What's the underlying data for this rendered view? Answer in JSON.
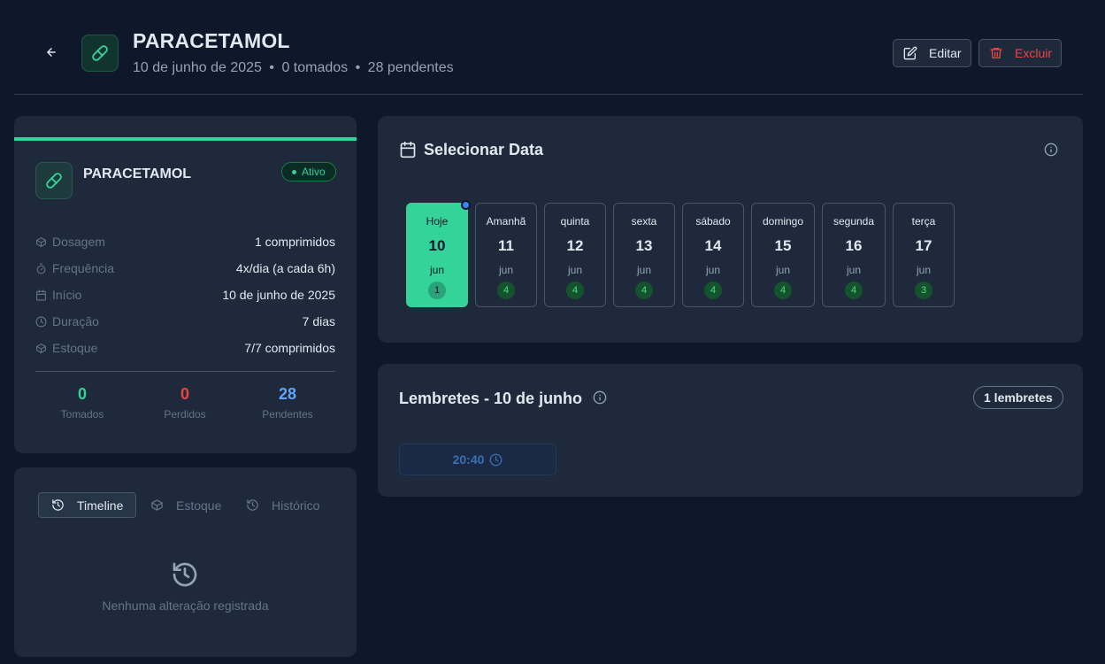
{
  "header": {
    "title": "PARACETAMOL",
    "subtitle": {
      "date": "10 de junho de 2025",
      "taken": "0 tomados",
      "pending": "28 pendentes",
      "separator": "•"
    },
    "edit_label": "Editar",
    "delete_label": "Excluir"
  },
  "medication": {
    "name": "PARACETAMOL",
    "status": "Ativo",
    "details": [
      {
        "icon": "box-icon",
        "label": "Dosagem",
        "value": "1 comprimidos"
      },
      {
        "icon": "timer-icon",
        "label": "Frequência",
        "value": "4x/dia (a cada 6h)"
      },
      {
        "icon": "calendar-icon",
        "label": "Início",
        "value": "10 de junho de 2025"
      },
      {
        "icon": "clock-icon",
        "label": "Duração",
        "value": "7 dias"
      },
      {
        "icon": "box-icon",
        "label": "Estoque",
        "value": "7/7 comprimidos"
      }
    ],
    "stats": [
      {
        "value": "0",
        "label": "Tomados",
        "color": "#34d399"
      },
      {
        "value": "0",
        "label": "Perdidos",
        "color": "#ef4444"
      },
      {
        "value": "28",
        "label": "Pendentes",
        "color": "#60a5fa"
      }
    ]
  },
  "tabs": {
    "items": [
      {
        "label": "Timeline",
        "icon": "history-icon",
        "active": true
      },
      {
        "label": "Estoque",
        "icon": "box-icon",
        "active": false
      },
      {
        "label": "Histórico",
        "icon": "history-icon",
        "active": false
      }
    ],
    "empty_text": "Nenhuma alteração registrada"
  },
  "date_selector": {
    "title": "Selecionar Data",
    "days": [
      {
        "name": "Hoje",
        "day": "10",
        "month": "jun",
        "count": "1",
        "selected": true
      },
      {
        "name": "Amanhã",
        "day": "11",
        "month": "jun",
        "count": "4",
        "selected": false
      },
      {
        "name": "quinta",
        "day": "12",
        "month": "jun",
        "count": "4",
        "selected": false
      },
      {
        "name": "sexta",
        "day": "13",
        "month": "jun",
        "count": "4",
        "selected": false
      },
      {
        "name": "sábado",
        "day": "14",
        "month": "jun",
        "count": "4",
        "selected": false
      },
      {
        "name": "domingo",
        "day": "15",
        "month": "jun",
        "count": "4",
        "selected": false
      },
      {
        "name": "segunda",
        "day": "16",
        "month": "jun",
        "count": "4",
        "selected": false
      },
      {
        "name": "terça",
        "day": "17",
        "month": "jun",
        "count": "3",
        "selected": false
      }
    ]
  },
  "reminders": {
    "title": "Lembretes - 10 de junho",
    "count_label": "1 lembretes",
    "times": [
      "20:40"
    ]
  },
  "colors": {
    "accent": "#34d399",
    "danger": "#ef4444",
    "info": "#60a5fa",
    "background": "#0f172a",
    "card": "#1e293b"
  }
}
